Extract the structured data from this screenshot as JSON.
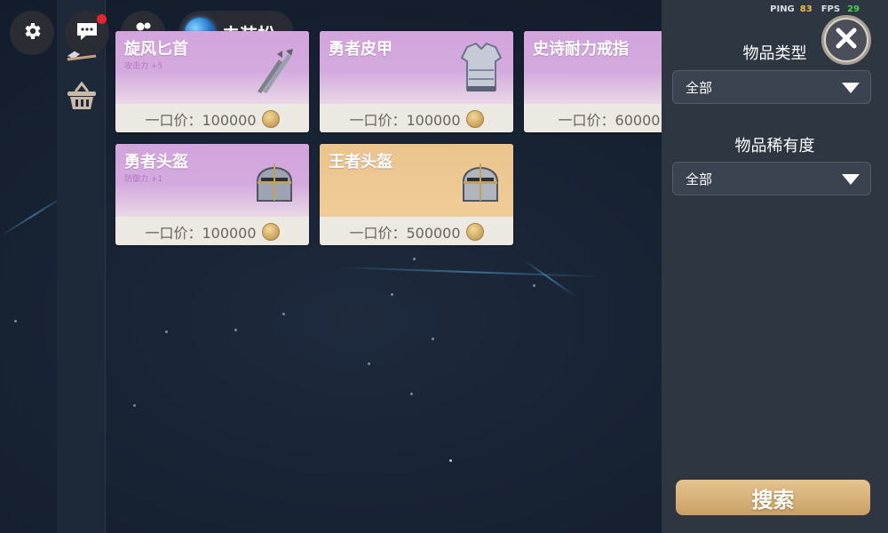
{
  "hud": {
    "ping_label": "PING",
    "ping_value": "83",
    "fps_label": "FPS",
    "fps_value": "29",
    "ping_color": "#f0c040",
    "fps_color": "#49d34b"
  },
  "topbar": {
    "settings_icon": "gear-icon",
    "chat_icon": "chat-icon",
    "chat_has_notification": true,
    "friends_icon": "friends-icon",
    "dress_label": "去装扮"
  },
  "left_rail": {
    "items": [
      {
        "icon": "sword-icon",
        "selected": true
      },
      {
        "icon": "basket-icon",
        "selected": false
      }
    ]
  },
  "items": [
    {
      "name": "旋风匕首",
      "subtitle": "攻击力 +5",
      "price": "一口价：100000",
      "rarity": "epic",
      "icon": "dagger-icon",
      "partially_obscured": true
    },
    {
      "name": "勇者皮甲",
      "subtitle": "",
      "price": "一口价：100000",
      "rarity": "epic",
      "icon": "armor-icon"
    },
    {
      "name": "史诗耐力戒指",
      "subtitle": "",
      "price": "一口价：60000",
      "rarity": "epic",
      "icon": "ring-icon"
    },
    {
      "name": "勇者头盔",
      "subtitle": "防御力 +1",
      "price": "一口价：100000",
      "rarity": "epic",
      "icon": "helmet-icon"
    },
    {
      "name": "王者头盔",
      "subtitle": "",
      "price": "一口价：500000",
      "rarity": "legendary",
      "icon": "helmet-icon"
    }
  ],
  "rarity_colors": {
    "epic": "#d2a5dc",
    "legendary": "#ebc48d"
  },
  "filters": {
    "type_label": "物品类型",
    "type_value": "全部",
    "rarity_label": "物品稀有度",
    "rarity_value": "全部"
  },
  "search_label": "搜索",
  "close_icon": "close-icon"
}
